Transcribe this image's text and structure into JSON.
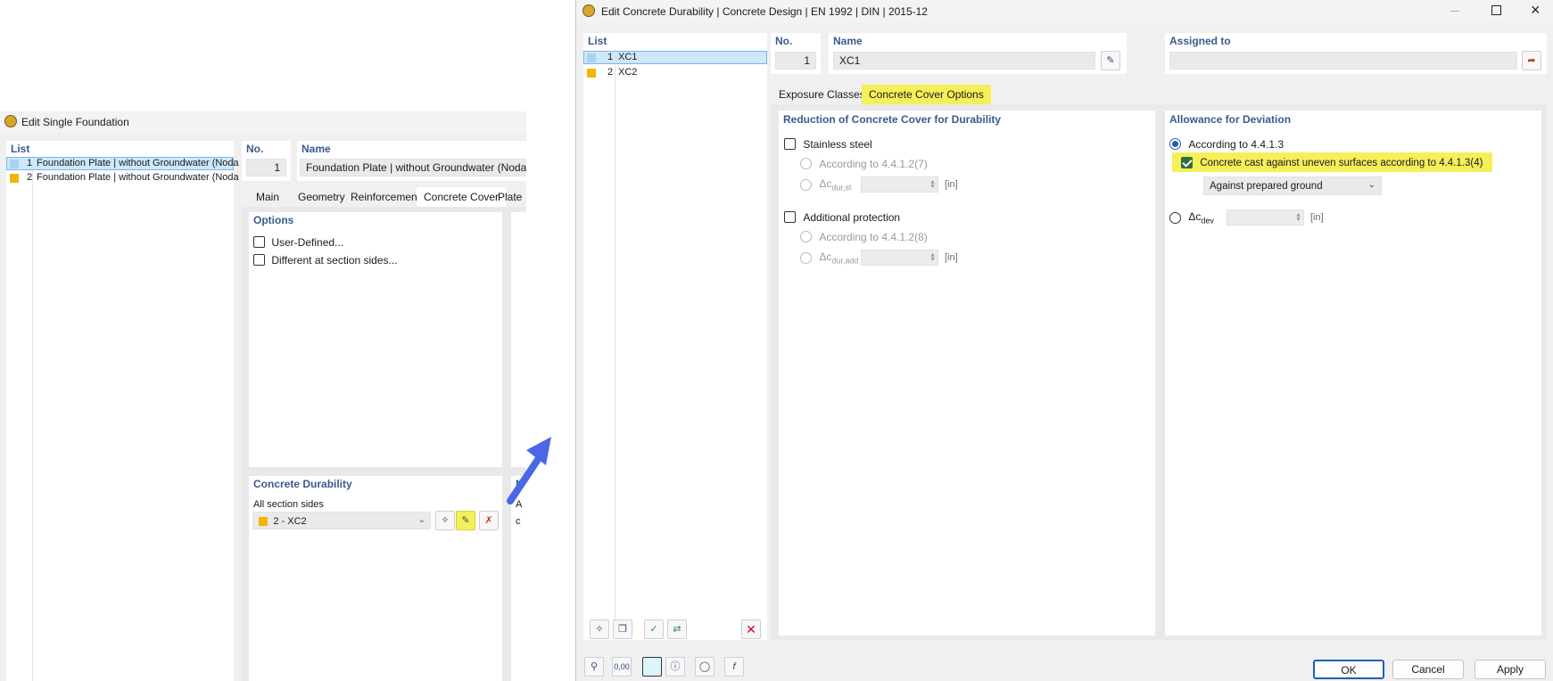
{
  "left_dialog": {
    "title": "Edit Single Foundation",
    "list_header": "List",
    "items": [
      {
        "no": "1",
        "name": "Foundation Plate | without Groundwater (Noda",
        "color": "#a9d2f2"
      },
      {
        "no": "2",
        "name": "Foundation Plate | without Groundwater (Noda",
        "color": "#f2b600"
      }
    ],
    "no_label": "No.",
    "no_value": "1",
    "name_label": "Name",
    "name_value": "Foundation Plate | without Groundwater (Nodal Sup",
    "tabs": [
      "Main",
      "Geometry",
      "Reinforcement",
      "Concrete Cover",
      "Plate"
    ],
    "options_header": "Options",
    "options": [
      "User-Defined...",
      "Different at section sides..."
    ],
    "durability_header": "Concrete Durability",
    "all_sides_label": "All section sides",
    "durability_value": "2 - XC2",
    "durability_color": "#f2b600",
    "cut_header": "N",
    "cut_a": "A",
    "cut_c": "c"
  },
  "right_dialog": {
    "title": "Edit Concrete Durability | Concrete Design | EN 1992 | DIN | 2015-12",
    "list_header": "List",
    "items": [
      {
        "no": "1",
        "name": "XC1",
        "color": "#a9d2f2"
      },
      {
        "no": "2",
        "name": "XC2",
        "color": "#f2b600"
      }
    ],
    "no_label": "No.",
    "no_value": "1",
    "name_label": "Name",
    "name_value": "XC1",
    "assigned_label": "Assigned to",
    "assigned_value": "",
    "tabs": [
      "Exposure Classes",
      "Concrete Cover Options"
    ],
    "reduction": {
      "header": "Reduction of Concrete Cover for Durability",
      "stainless_label": "Stainless steel",
      "stainless_opt1": "According to 4.4.1.2(7)",
      "stainless_delta_base": "Δc",
      "stainless_delta_sub": "dur,st",
      "stainless_unit": "[in]",
      "additional_label": "Additional protection",
      "additional_opt1": "According to 4.4.1.2(8)",
      "additional_delta_base": "Δc",
      "additional_delta_sub": "dur,add",
      "additional_unit": "[in]"
    },
    "allowance": {
      "header": "Allowance for Deviation",
      "radio1": "According to 4.4.1.3",
      "checkbox": "Concrete cast against uneven surfaces according to 4.4.1.3(4)",
      "select_value": "Against prepared ground",
      "delta_base": "Δc",
      "delta_sub": "dev",
      "unit": "[in]"
    },
    "buttons": {
      "ok": "OK",
      "cancel": "Cancel",
      "apply": "Apply"
    },
    "bottom_value_icon": "0,00"
  },
  "colors": {
    "highlight": "#f5ef5a",
    "arrow": "#4a67e6",
    "header_text": "#3a5a8c",
    "selection": "#cde8fb"
  }
}
